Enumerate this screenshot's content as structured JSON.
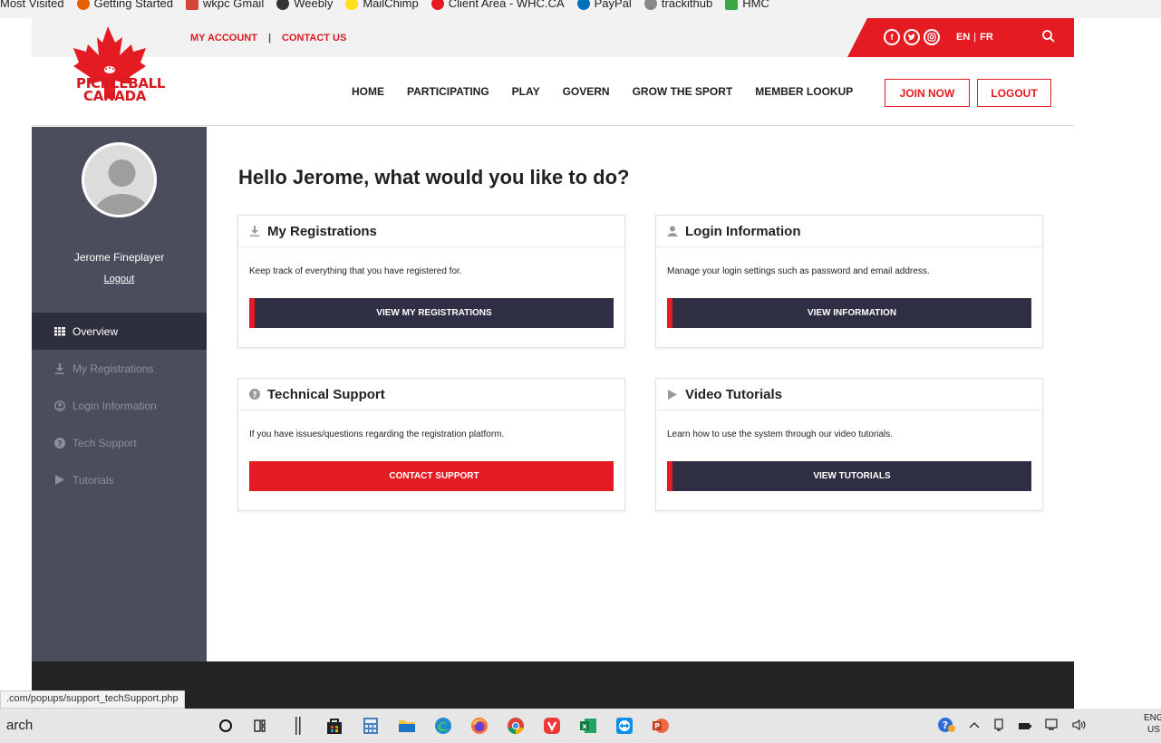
{
  "bookmarks": [
    {
      "label": "Most Visited",
      "color": "#f2f2f2"
    },
    {
      "label": "Getting Started",
      "color": "#e66000"
    },
    {
      "label": "wkpc Gmail",
      "color": "#d44638"
    },
    {
      "label": "Weebly",
      "color": "#333333"
    },
    {
      "label": "MailChimp",
      "color": "#ffe01b"
    },
    {
      "label": "Client Area - WHC.CA",
      "color": "#e41b23"
    },
    {
      "label": "PayPal",
      "color": "#0070ba"
    },
    {
      "label": "trackithub",
      "color": "#888888"
    },
    {
      "label": "HMC",
      "color": "#3aa845"
    }
  ],
  "utility": {
    "my_account": "MY ACCOUNT",
    "separator": "|",
    "contact_us": "CONTACT US",
    "lang_en": "EN",
    "lang_sep": "|",
    "lang_fr": "FR"
  },
  "logo": {
    "line1": "PICKLEBALL",
    "line2": "CANADA"
  },
  "nav": {
    "items": [
      "HOME",
      "PARTICIPATING",
      "PLAY",
      "GOVERN",
      "GROW THE SPORT",
      "MEMBER LOOKUP"
    ],
    "join_now": "JOIN NOW",
    "logout": "LOGOUT"
  },
  "sidebar": {
    "username": "Jerome Fineplayer",
    "logout": "Logout",
    "items": [
      {
        "label": "Overview",
        "icon": "grid-icon"
      },
      {
        "label": "My Registrations",
        "icon": "download-icon"
      },
      {
        "label": "Login Information",
        "icon": "user-icon"
      },
      {
        "label": "Tech Support",
        "icon": "question-icon"
      },
      {
        "label": "Tutorials",
        "icon": "play-icon"
      }
    ]
  },
  "main": {
    "greeting": "Hello Jerome, what would you like to do?",
    "cards": [
      {
        "title": "My Registrations",
        "desc": "Keep track of everything that you have registered for.",
        "button": "VIEW MY REGISTRATIONS",
        "icon": "download-icon"
      },
      {
        "title": "Login Information",
        "desc": "Manage your login settings such as password and email address.",
        "button": "VIEW INFORMATION",
        "icon": "user-icon"
      },
      {
        "title": "Technical Support",
        "desc": "If you have issues/questions regarding the registration platform.",
        "button": "CONTACT SUPPORT",
        "icon": "question-icon"
      },
      {
        "title": "Video Tutorials",
        "desc": "Learn how to use the system through our video tutorials.",
        "button": "VIEW TUTORIALS",
        "icon": "play-icon"
      }
    ]
  },
  "status_url": ".com/popups/support_techSupport.php",
  "taskbar": {
    "search": "arch",
    "tray_lang": "ENG",
    "tray_region": "US"
  },
  "colors": {
    "brand_red": "#e41b23",
    "sidebar": "#4a4d5c",
    "sidebar_active": "#2d2f3e",
    "button_dark": "#2e2f45"
  }
}
